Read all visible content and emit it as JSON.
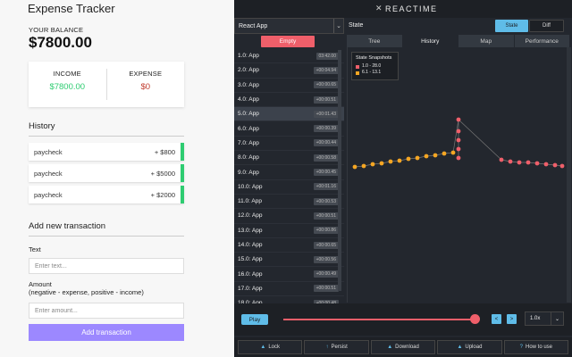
{
  "expense": {
    "title": "Expense Tracker",
    "balance_label": "YOUR BALANCE",
    "balance": "$7800.00",
    "income_label": "INCOME",
    "income": "$7800.00",
    "expense_label": "EXPENSE",
    "expense": "$0",
    "history_title": "History",
    "history": [
      {
        "name": "paycheck",
        "amount": "+ $800"
      },
      {
        "name": "paycheck",
        "amount": "+ $5000"
      },
      {
        "name": "paycheck",
        "amount": "+ $2000"
      }
    ],
    "add_title": "Add new transaction",
    "text_label": "Text",
    "text_placeholder": "Enter text...",
    "amount_label_1": "Amount",
    "amount_label_2": "(negative - expense, positive - income)",
    "amount_placeholder": "Enter amount...",
    "add_button": "Add transaction"
  },
  "reactime": {
    "logo": "REACTIME",
    "tab_select": "React App",
    "empty_button": "Empty",
    "snapshots": [
      {
        "label": "1.0: App",
        "time": "03:42.00"
      },
      {
        "label": "2.0: App",
        "time": "+00:04.94"
      },
      {
        "label": "3.0: App",
        "time": "+00:00.65"
      },
      {
        "label": "4.0: App",
        "time": "+00:00.51"
      },
      {
        "label": "5.0: App",
        "time": "+00:01.43"
      },
      {
        "label": "6.0: App",
        "time": "+00:00.39"
      },
      {
        "label": "7.0: App",
        "time": "+00:00.44"
      },
      {
        "label": "8.0: App",
        "time": "+00:00.58"
      },
      {
        "label": "9.0: App",
        "time": "+00:00.45"
      },
      {
        "label": "10.0: App",
        "time": "+00:01.16"
      },
      {
        "label": "11.0: App",
        "time": "+00:00.53"
      },
      {
        "label": "12.0: App",
        "time": "+00:00.51"
      },
      {
        "label": "13.0: App",
        "time": "+00:00.86"
      },
      {
        "label": "14.0: App",
        "time": "+00:00.65"
      },
      {
        "label": "15.0: App",
        "time": "+00:00.56"
      },
      {
        "label": "16.0: App",
        "time": "+00:00.49"
      },
      {
        "label": "17.0: App",
        "time": "+00:00.51"
      },
      {
        "label": "18.0: App",
        "time": "+00:00.48"
      }
    ],
    "active_index": 4,
    "state_label": "State",
    "state_button": "State",
    "diff_button": "Diff",
    "tabs": [
      "Tree",
      "History",
      "Map",
      "Performance"
    ],
    "active_tab": 1,
    "legend_title": "State Snapshots",
    "legend_items": [
      {
        "label": "1.0 - 28.0",
        "color": "#ef5f6a"
      },
      {
        "label": "6.1 - 13.1",
        "color": "#f5a623"
      }
    ],
    "play": "Play",
    "prev": "<",
    "next": ">",
    "speed": "1.0x",
    "actions": [
      {
        "label": "Lock",
        "icon": "lock-icon"
      },
      {
        "label": "Persist",
        "icon": "persist-icon"
      },
      {
        "label": "Download",
        "icon": "download-icon"
      },
      {
        "label": "Upload",
        "icon": "upload-icon"
      },
      {
        "label": "How to use",
        "icon": "help-icon"
      }
    ],
    "colors": {
      "accent": "#5fbce8",
      "red": "#ef5f6a",
      "orange": "#f5a623",
      "bg": "#23272e"
    }
  }
}
